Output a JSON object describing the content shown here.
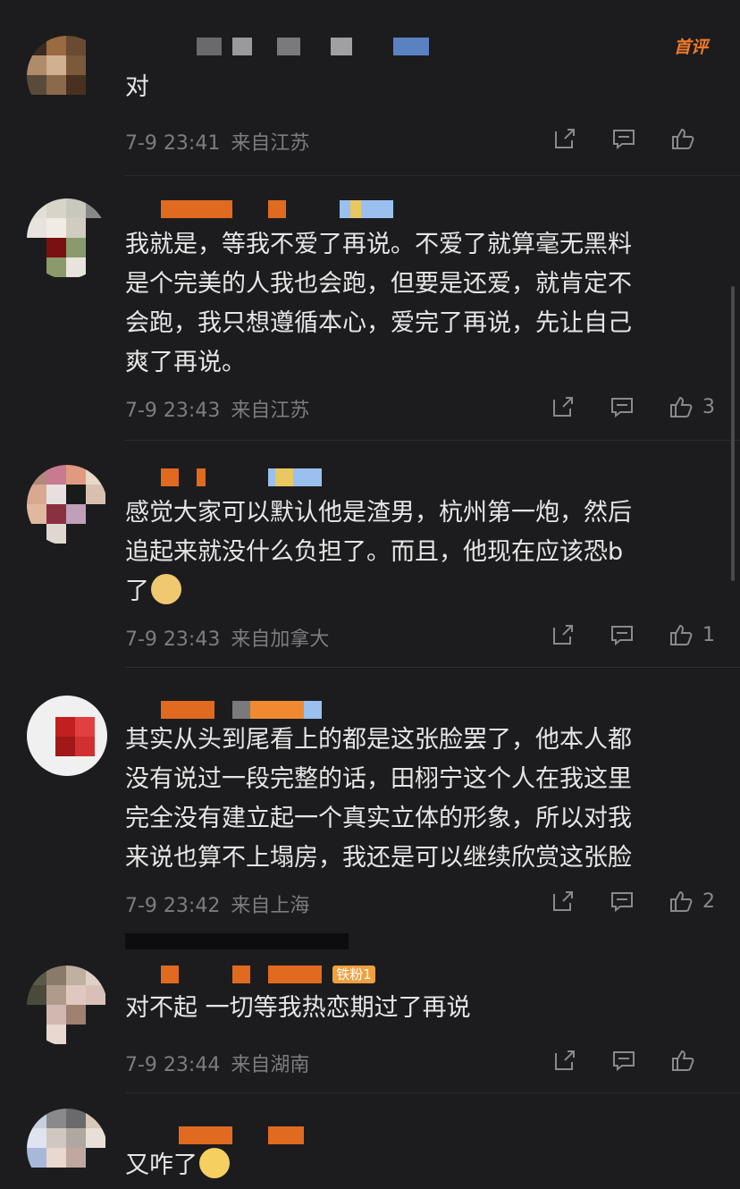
{
  "comments": [
    {
      "text": "对",
      "time": "7-9 23:41",
      "location": "来自江苏",
      "likes": "",
      "badge": "首评"
    },
    {
      "text": "我就是，等我不爱了再说。不爱了就算毫无黑料\n是个完美的人我也会跑，但要是还爱，就肯定不\n会跑，我只想遵循本心，爱完了再说，先让自己\n爽了再说。",
      "time": "7-9 23:43",
      "location": "来自江苏",
      "likes": "3"
    },
    {
      "text": "感觉大家可以默认他是渣男，杭州第一炮，然后\n追起来就没什么负担了。而且，他现在应该恐b\n了",
      "time": "7-9 23:43",
      "location": "来自加拿大",
      "likes": "1"
    },
    {
      "text": "其实从头到尾看上的都是这张脸罢了，他本人都\n没有说过一段完整的话，田栩宁这个人在我这里\n完全没有建立起一个真实立体的形象，所以对我\n来说也算不上塌房，我还是可以继续欣赏这张脸",
      "time": "7-9 23:42",
      "location": "来自上海",
      "likes": "2"
    },
    {
      "text": "对不起 一切等我热恋期过了再说",
      "time": "7-9 23:44",
      "location": "来自湖南",
      "likes": "",
      "fan_badge": "铁粉1"
    },
    {
      "text": "又咋了",
      "time": "",
      "location": "",
      "likes": ""
    }
  ],
  "icons": {
    "share": "share-icon",
    "reply": "comment-icon",
    "like": "thumbs-up-icon"
  },
  "colors": {
    "background": "#1c1c1e",
    "text": "#e6e6e6",
    "meta": "#7d7d80",
    "badge": "#f07a2a"
  }
}
